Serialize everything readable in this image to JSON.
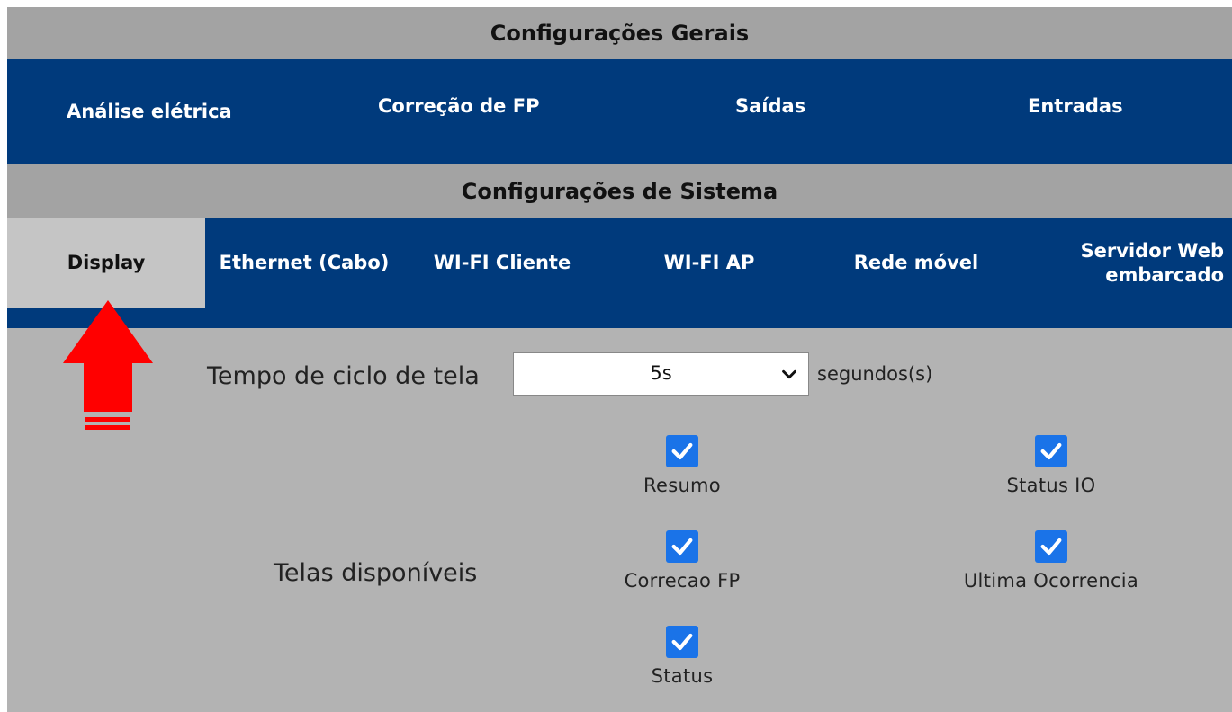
{
  "general": {
    "title": "Configurações Gerais",
    "tabs": [
      {
        "label": "Análise elétrica"
      },
      {
        "label": "Correção de FP"
      },
      {
        "label": "Saídas"
      },
      {
        "label": "Entradas"
      }
    ]
  },
  "system": {
    "title": "Configurações de Sistema",
    "tabs": [
      {
        "label": "Display",
        "active": true
      },
      {
        "label": "Ethernet (Cabo)"
      },
      {
        "label": "WI-FI Cliente"
      },
      {
        "label": "WI-FI AP"
      },
      {
        "label": "Rede móvel"
      },
      {
        "label": "Servidor Web embarcado"
      }
    ]
  },
  "display": {
    "cycle_label": "Tempo de ciclo de tela",
    "cycle_value": "5s",
    "cycle_unit": "segundos(s)",
    "screens_label": "Telas disponíveis",
    "screens": [
      {
        "label": "Resumo",
        "checked": true
      },
      {
        "label": "Status IO",
        "checked": true
      },
      {
        "label": "Correcao FP",
        "checked": true
      },
      {
        "label": "Ultima Ocorrencia",
        "checked": true
      },
      {
        "label": "Status",
        "checked": true
      }
    ]
  },
  "colors": {
    "nav_blue": "#003a7c",
    "checkbox_blue": "#1a73e8",
    "arrow_red": "#ff0000",
    "active_tab": "#c5c5c5"
  },
  "icons": {
    "arrow": "red-up-arrow-icon",
    "select": "chevron-down-icon",
    "checkbox": "checkmark-icon"
  }
}
